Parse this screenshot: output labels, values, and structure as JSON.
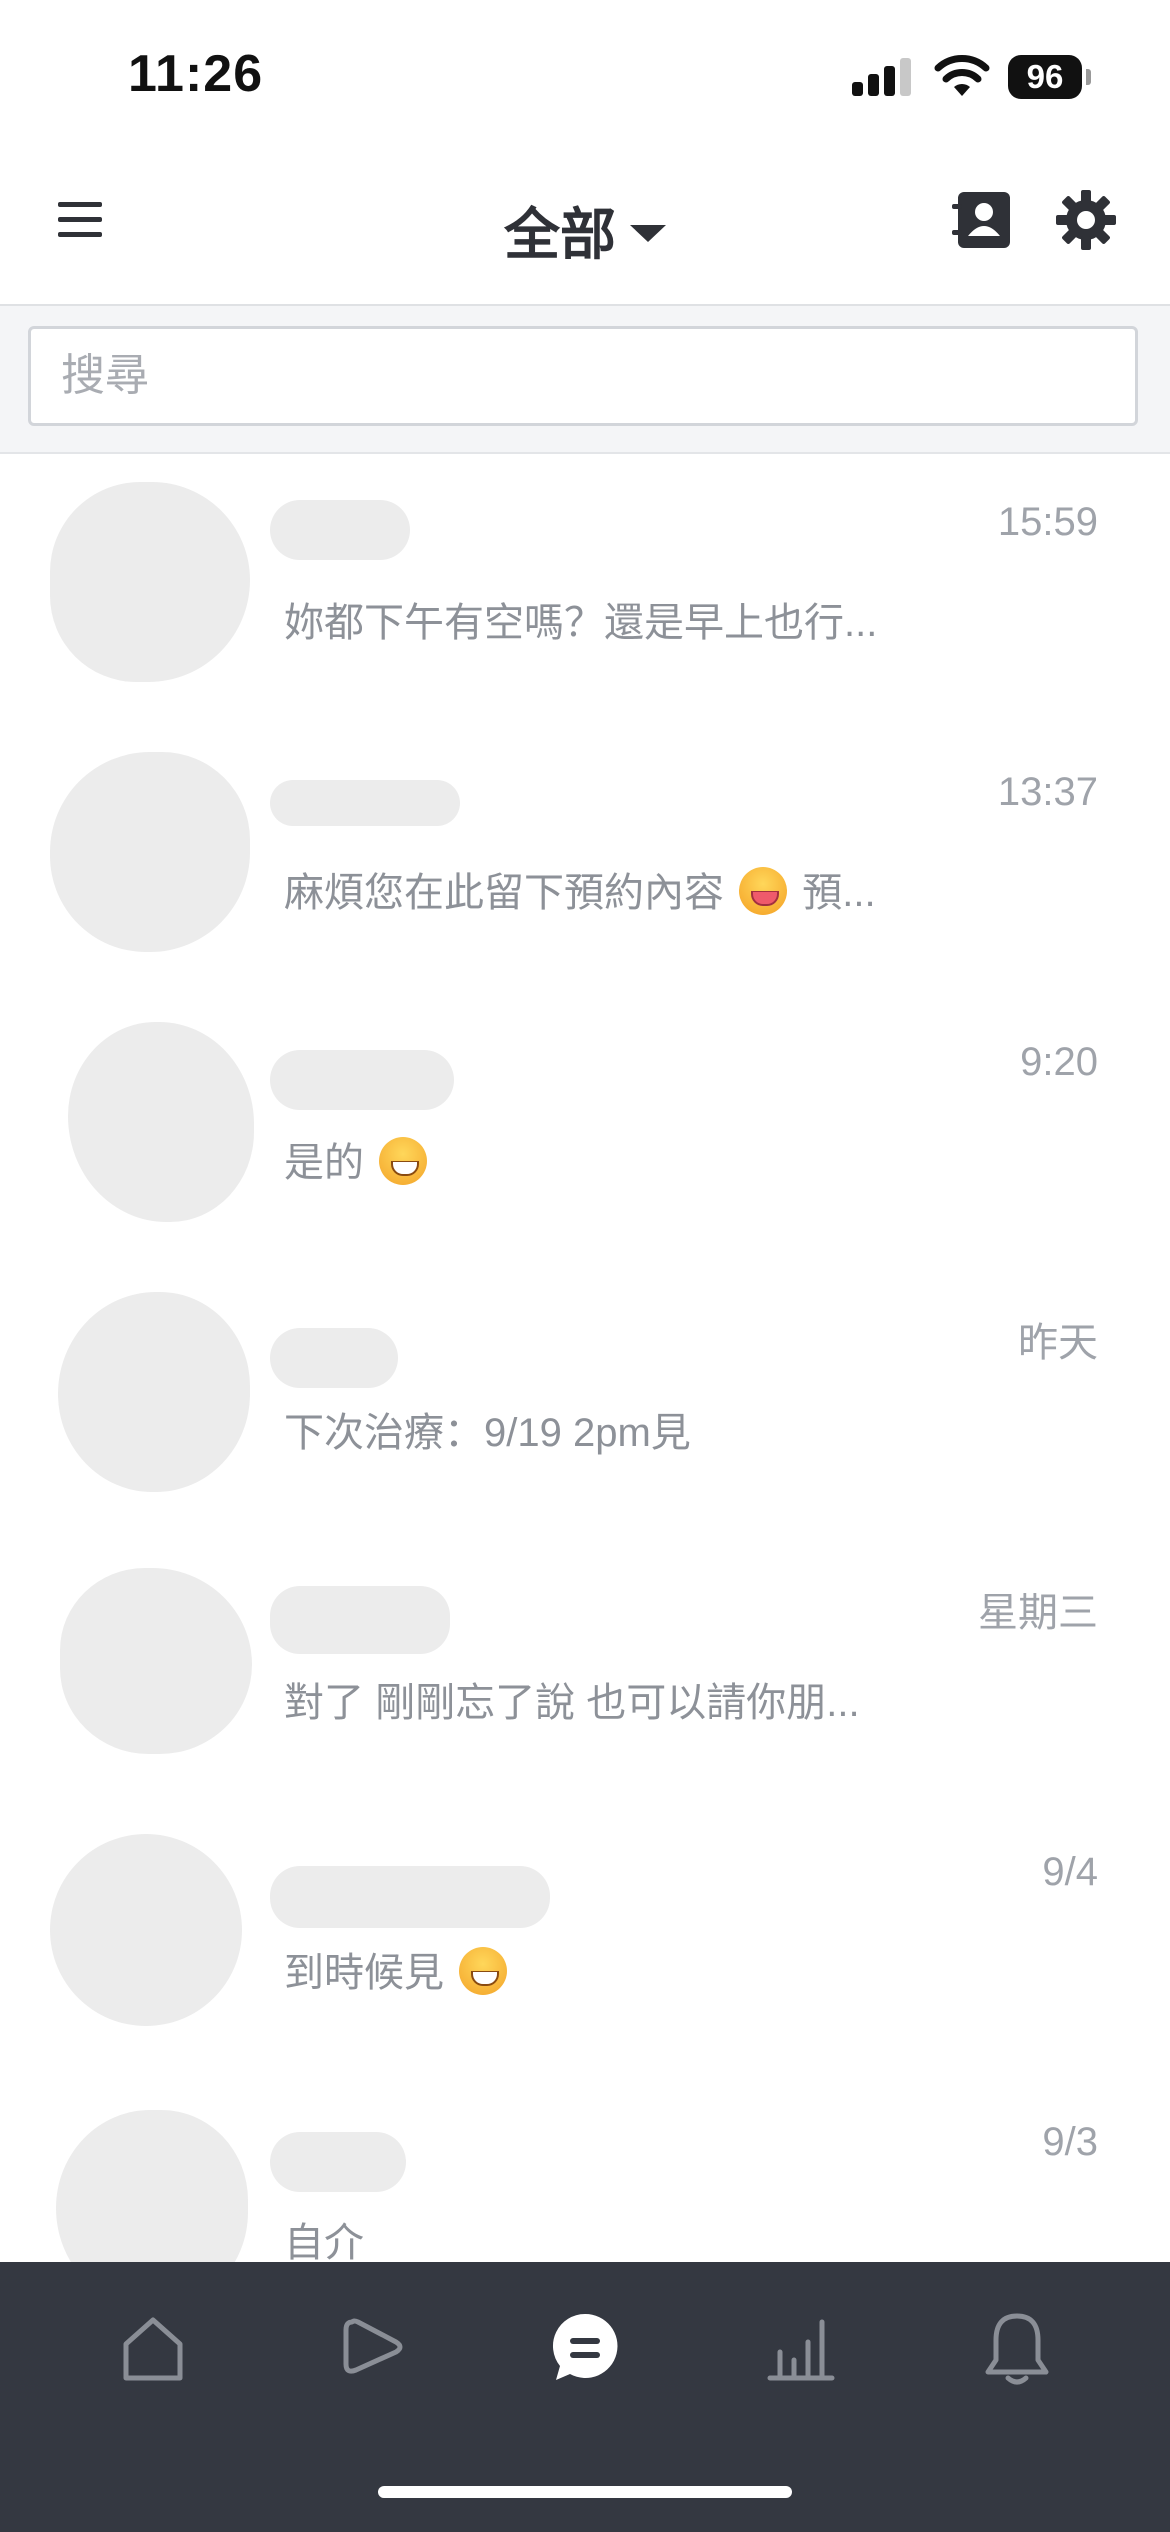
{
  "status_bar": {
    "time": "11:26",
    "battery": "96"
  },
  "header": {
    "title": "全部"
  },
  "search": {
    "placeholder": "搜尋",
    "value": ""
  },
  "chats": [
    {
      "time": "15:59",
      "preview": "妳都下午有空嗎？還是早上也行...",
      "emoji": ""
    },
    {
      "time": "13:37",
      "preview": "麻煩您在此留下預約內容",
      "emoji": "tongue",
      "preview_after": "預..."
    },
    {
      "time": "9:20",
      "preview": "是的",
      "emoji": "grin",
      "preview_after": ""
    },
    {
      "time": "昨天",
      "preview": "下次治療：9/19 2pm見",
      "emoji": ""
    },
    {
      "time": "星期三",
      "preview": "對了 剛剛忘了說 也可以請你朋...",
      "emoji": ""
    },
    {
      "time": "9/4",
      "preview": "到時候見",
      "emoji": "grin",
      "preview_after": ""
    },
    {
      "time": "9/3",
      "preview": "自介",
      "emoji": ""
    }
  ],
  "bottom_nav": {
    "items": [
      {
        "icon": "home-icon",
        "active": false
      },
      {
        "icon": "play-icon",
        "active": false
      },
      {
        "icon": "chat-icon",
        "active": true
      },
      {
        "icon": "stats-icon",
        "active": false
      },
      {
        "icon": "bell-icon",
        "active": false
      }
    ]
  }
}
